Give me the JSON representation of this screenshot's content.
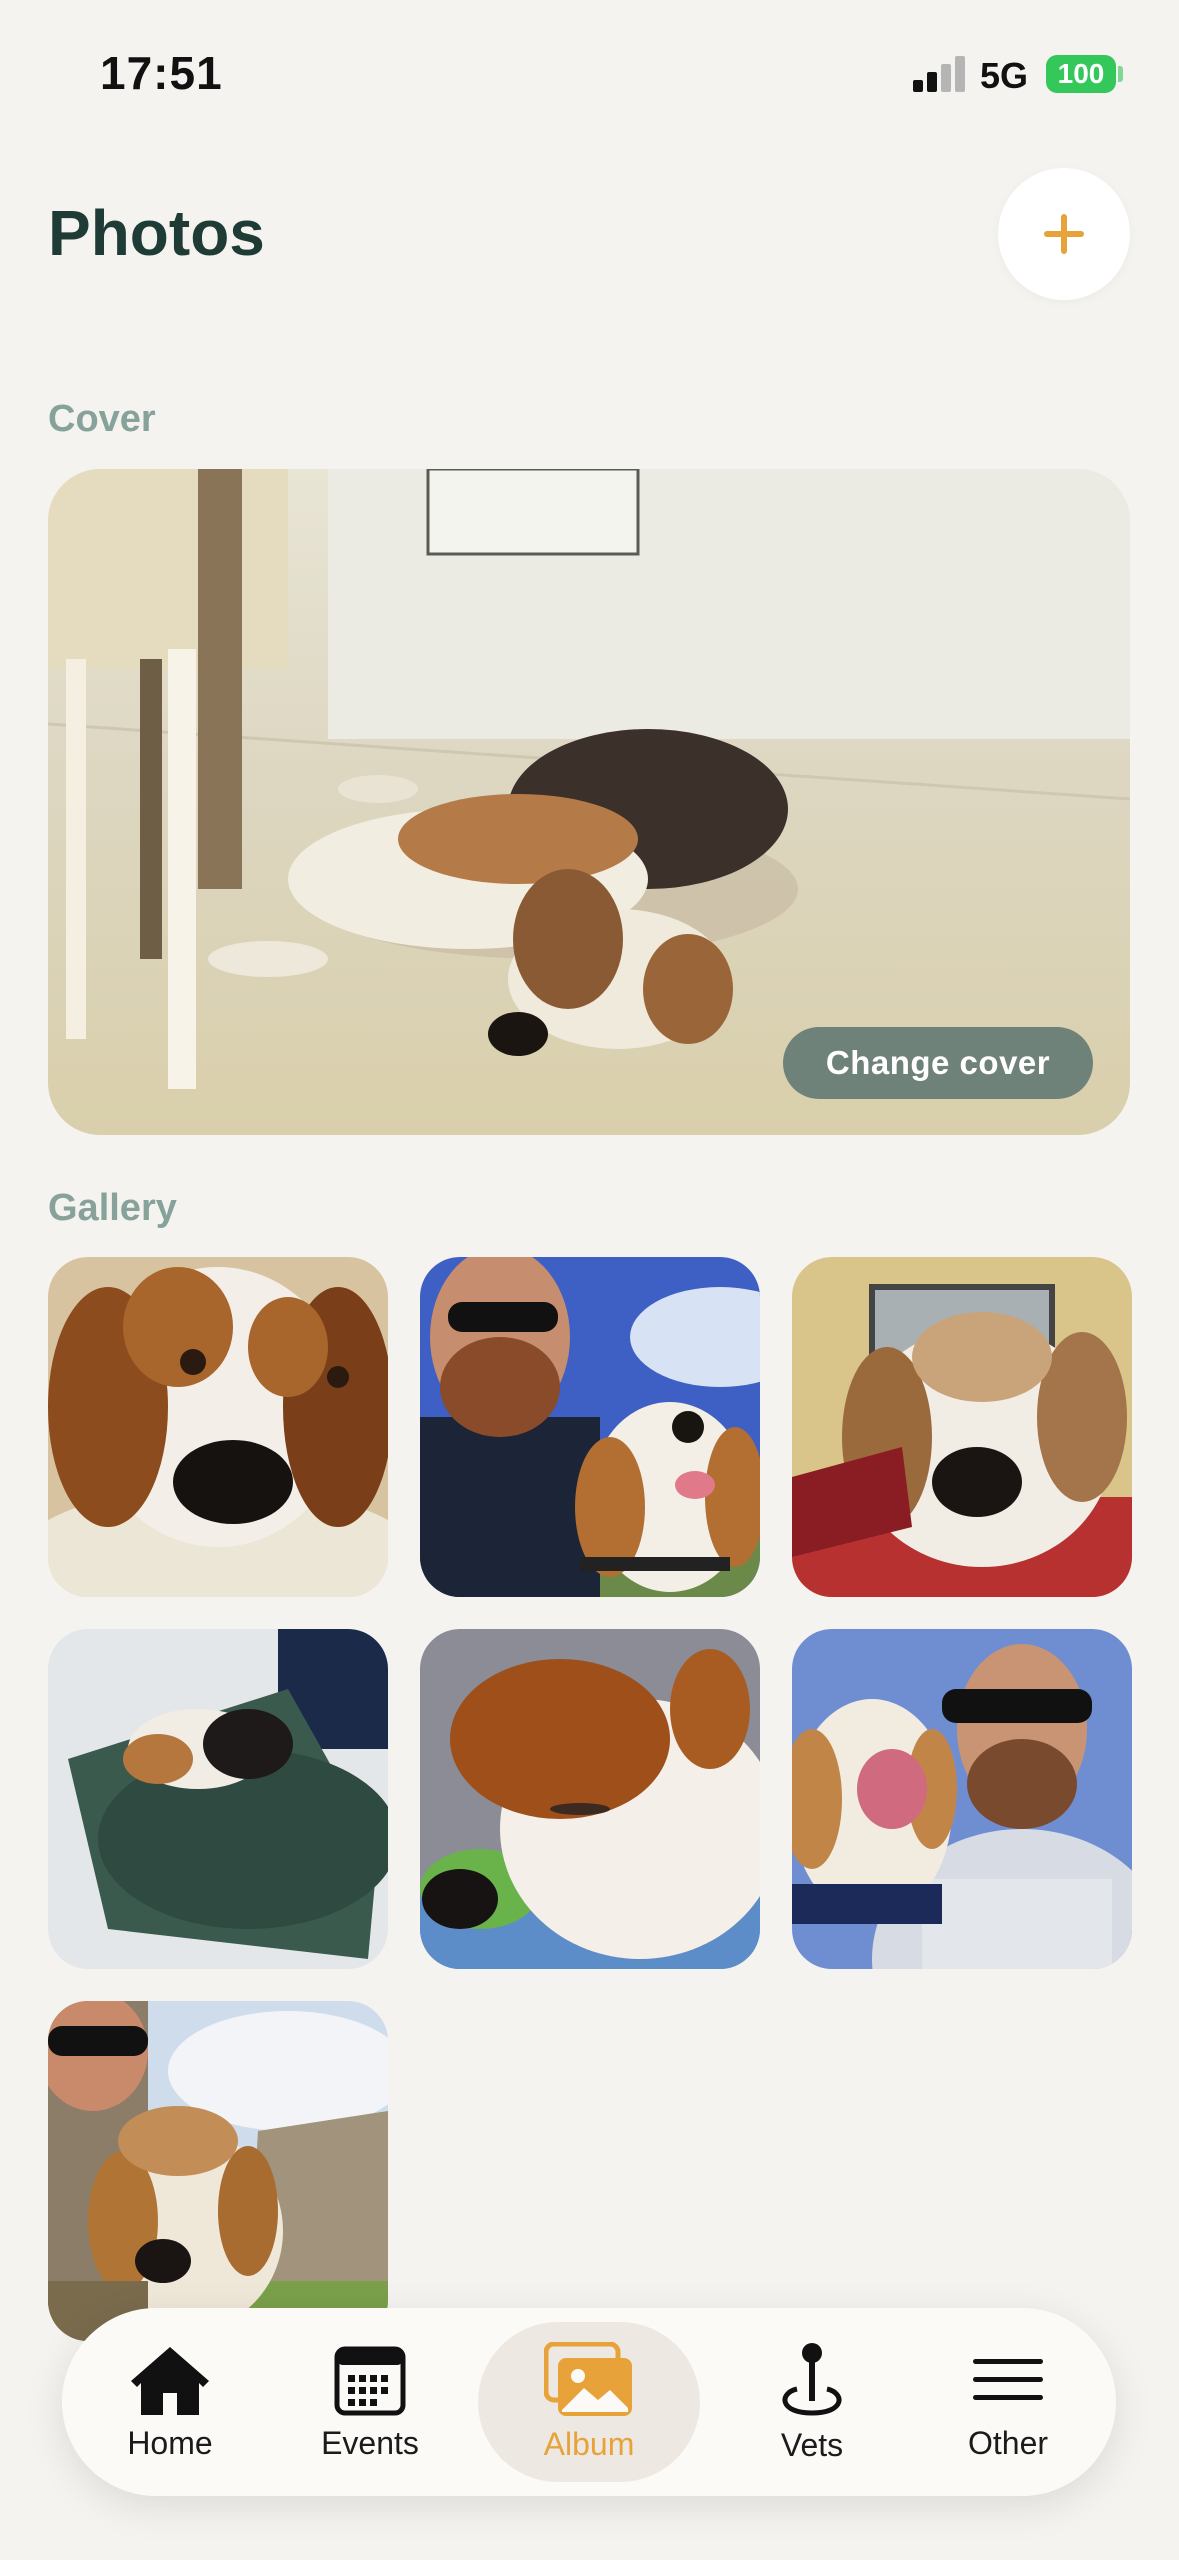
{
  "status_bar": {
    "time": "17:51",
    "network": "5G",
    "battery": "100"
  },
  "header": {
    "title": "Photos",
    "add_icon": "plus-icon"
  },
  "cover": {
    "label": "Cover",
    "change_button": "Change cover"
  },
  "gallery": {
    "label": "Gallery",
    "photo_count": 7
  },
  "tab_bar": {
    "accent": "#e8a23a",
    "items": [
      {
        "label": "Home",
        "icon": "house-icon"
      },
      {
        "label": "Events",
        "icon": "calendar-icon"
      },
      {
        "label": "Album",
        "icon": "photos-icon",
        "active": true
      },
      {
        "label": "Vets",
        "icon": "location-pin-icon"
      },
      {
        "label": "Other",
        "icon": "menu-icon"
      }
    ]
  },
  "colors": {
    "background": "#f5f3ef",
    "title": "#1f3b36",
    "section_label": "#86a29b",
    "change_cover_bg": "#6f8279"
  }
}
